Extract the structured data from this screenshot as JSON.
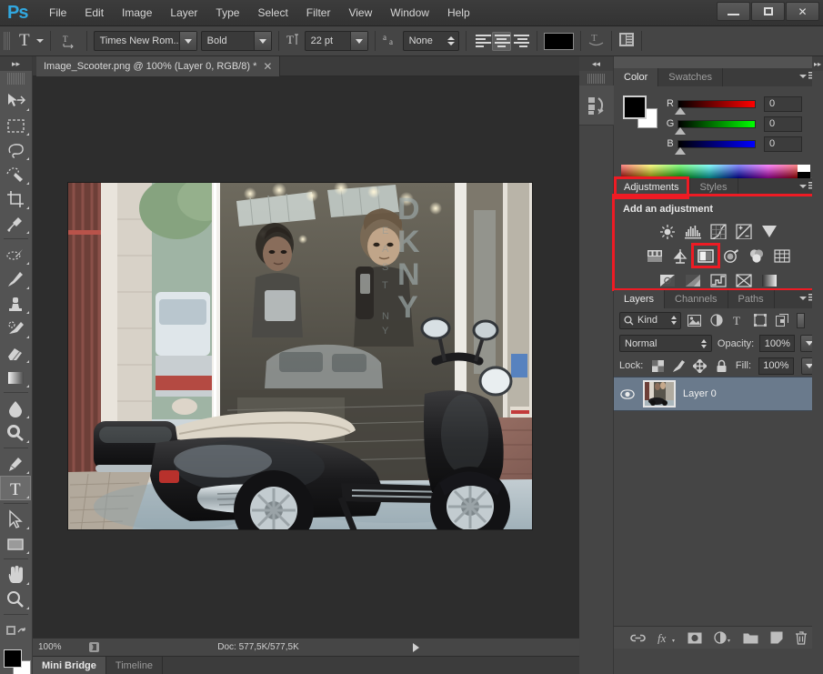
{
  "app": {
    "logo": "Ps"
  },
  "menubar": {
    "items": [
      "File",
      "Edit",
      "Image",
      "Layer",
      "Type",
      "Select",
      "Filter",
      "View",
      "Window",
      "Help"
    ]
  },
  "window_controls": {
    "minimize": "minimize-button",
    "maximize": "maximize-button",
    "close": "✕"
  },
  "options_bar": {
    "tool_glyph": "T",
    "orientation_icon": "text-orientation-icon",
    "font_family": "Times New Rom...",
    "font_style": "Bold",
    "size_icon": "font-size-icon",
    "font_size": "22 pt",
    "antialias_icon": "anti-aliasing-icon",
    "antialias_value": "None",
    "align_left": "align-left",
    "align_center": "align-center",
    "align_right": "align-right",
    "color_swatch": "#000000",
    "warp_icon": "warp-text-icon",
    "panels_icon": "character-panel-icon"
  },
  "toolbar": {
    "collapse": "▸▸",
    "tools": [
      {
        "name": "move-tool",
        "glyph": "move"
      },
      {
        "name": "marquee-tool",
        "glyph": "marquee"
      },
      {
        "name": "lasso-tool",
        "glyph": "lasso"
      },
      {
        "name": "quick-selection-tool",
        "glyph": "quickselect"
      },
      {
        "name": "crop-tool",
        "glyph": "crop"
      },
      {
        "name": "eyedropper-tool",
        "glyph": "eyedropper"
      },
      {
        "name": "healing-brush-tool",
        "glyph": "healing"
      },
      {
        "name": "brush-tool",
        "glyph": "brush"
      },
      {
        "name": "clone-stamp-tool",
        "glyph": "stamp"
      },
      {
        "name": "history-brush-tool",
        "glyph": "historybrush"
      },
      {
        "name": "eraser-tool",
        "glyph": "eraser"
      },
      {
        "name": "gradient-tool",
        "glyph": "gradient"
      },
      {
        "name": "blur-tool",
        "glyph": "blur"
      },
      {
        "name": "dodge-tool",
        "glyph": "dodge"
      },
      {
        "name": "pen-tool",
        "glyph": "pen"
      },
      {
        "name": "type-tool",
        "glyph": "type",
        "selected": true
      },
      {
        "name": "path-selection-tool",
        "glyph": "pathselect"
      },
      {
        "name": "rectangle-tool",
        "glyph": "rectangle"
      },
      {
        "name": "hand-tool",
        "glyph": "hand"
      },
      {
        "name": "zoom-tool",
        "glyph": "zoom"
      }
    ],
    "foreground_color": "#000000",
    "background_color": "#ffffff"
  },
  "document": {
    "tab_title": "Image_Scooter.png @ 100% (Layer 0, RGB/8) *",
    "tab_close": "✕"
  },
  "status_bar": {
    "zoom": "100%",
    "doc_info": "Doc: 577,5K/577,5K"
  },
  "bottom_tabs": {
    "items": [
      {
        "label": "Mini Bridge",
        "active": true
      },
      {
        "label": "Timeline",
        "active": false
      }
    ]
  },
  "mini_dock": {
    "history_icon": "history-actions-icon"
  },
  "color_panel": {
    "tabs": [
      {
        "label": "Color",
        "active": true
      },
      {
        "label": "Swatches",
        "active": false
      }
    ],
    "channels": [
      {
        "label": "R",
        "value": "0"
      },
      {
        "label": "G",
        "value": "0"
      },
      {
        "label": "B",
        "value": "0"
      }
    ],
    "menu_icon": "panel-menu-icon"
  },
  "adjustments_panel": {
    "tabs": [
      {
        "label": "Adjustments",
        "active": true
      },
      {
        "label": "Styles",
        "active": false
      }
    ],
    "heading": "Add an adjustment",
    "highlight_color": "#ee1b24",
    "rows": [
      [
        {
          "name": "brightness-contrast-icon",
          "glyph": "sun"
        },
        {
          "name": "levels-icon",
          "glyph": "levels"
        },
        {
          "name": "curves-icon",
          "glyph": "curves"
        },
        {
          "name": "exposure-icon",
          "glyph": "exposure"
        },
        {
          "name": "vibrance-icon",
          "glyph": "vibrance"
        }
      ],
      [
        {
          "name": "hue-saturation-icon",
          "glyph": "huesat"
        },
        {
          "name": "color-balance-icon",
          "glyph": "balance"
        },
        {
          "name": "black-and-white-icon",
          "glyph": "bw",
          "highlighted": true
        },
        {
          "name": "photo-filter-icon",
          "glyph": "photofilter"
        },
        {
          "name": "channel-mixer-icon",
          "glyph": "mixer"
        },
        {
          "name": "color-lookup-icon",
          "glyph": "lookup"
        }
      ],
      [
        {
          "name": "invert-icon",
          "glyph": "invert"
        },
        {
          "name": "posterize-icon",
          "glyph": "posterize"
        },
        {
          "name": "threshold-icon",
          "glyph": "threshold"
        },
        {
          "name": "selective-color-icon",
          "glyph": "selective"
        },
        {
          "name": "gradient-map-icon",
          "glyph": "gradmap"
        }
      ]
    ]
  },
  "layers_panel": {
    "tabs": [
      {
        "label": "Layers",
        "active": true
      },
      {
        "label": "Channels",
        "active": false
      },
      {
        "label": "Paths",
        "active": false
      }
    ],
    "filter_label": "Kind",
    "filter_icons": [
      "pixel-filter-icon",
      "adjustment-filter-icon",
      "type-filter-icon",
      "shape-filter-icon",
      "smartobject-filter-icon"
    ],
    "blend_mode": "Normal",
    "opacity_label": "Opacity:",
    "opacity_value": "100%",
    "lock_label": "Lock:",
    "lock_icons": [
      "lock-transparent-icon",
      "lock-image-icon",
      "lock-position-icon",
      "lock-all-icon"
    ],
    "fill_label": "Fill:",
    "fill_value": "100%",
    "layers": [
      {
        "name": "Layer 0",
        "visible": true,
        "selected": true
      }
    ],
    "footer_icons": [
      "link-layers-icon",
      "layer-style-icon",
      "layer-mask-icon",
      "new-adjustment-icon",
      "new-group-icon",
      "new-layer-icon",
      "delete-layer-icon"
    ]
  }
}
